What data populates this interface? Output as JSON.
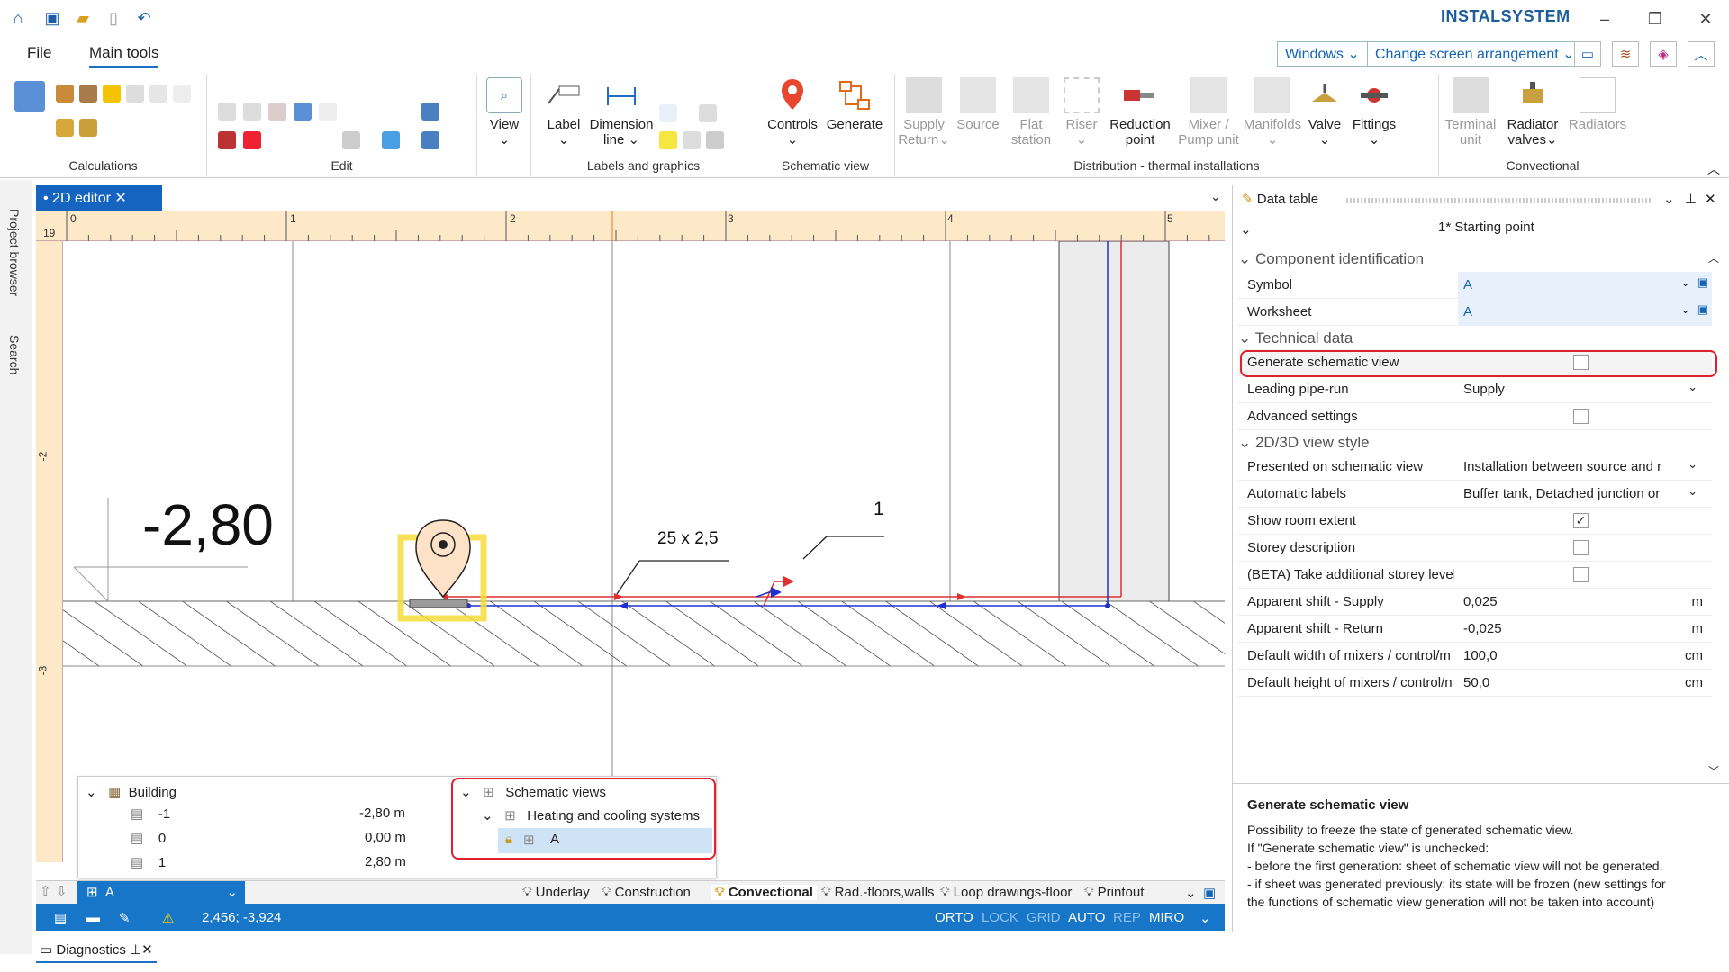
{
  "app": {
    "brand": "INSTALSYSTEM"
  },
  "menu": {
    "file": "File",
    "main_tools": "Main tools"
  },
  "toolbar": {
    "windows": "Windows",
    "arrangement": "Change screen arrangement"
  },
  "ribbon": {
    "calculations": "Calculations",
    "edit": "Edit",
    "labels_graphics": "Labels and graphics",
    "schematic_view": "Schematic view",
    "distribution": "Distribution - thermal installations",
    "convectional": "Convectional",
    "view": "View",
    "label": "Label",
    "dimension": "Dimension",
    "dimension2": "line",
    "controls": "Controls",
    "generate": "Generate",
    "supply": "Supply",
    "return": "Return",
    "source": "Source",
    "flat": "Flat",
    "station": "station",
    "riser": "Riser",
    "reduction": "Reduction",
    "point": "point",
    "mixer": "Mixer /",
    "pump": "Pump unit",
    "manifolds": "Manifolds",
    "valve": "Valve",
    "fittings": "Fittings",
    "terminal": "Terminal",
    "unit": "unit",
    "radiator": "Radiator",
    "valves": "valves",
    "radiators": "Radiators"
  },
  "left_tabs": {
    "project": "Project browser",
    "search": "Search"
  },
  "editor": {
    "tab": "• 2D editor",
    "ruler_h": [
      "0",
      "1",
      "2",
      "3",
      "4",
      "5"
    ],
    "ruler_v": [
      "-2",
      "-3"
    ],
    "corner": "19",
    "level": "-2,80",
    "pipe_label": "25 x 2,5",
    "marker": "1"
  },
  "tree": {
    "building": "Building",
    "levels": [
      {
        "name": "-1",
        "value": "-2,80 m"
      },
      {
        "name": "0",
        "value": "0,00 m"
      },
      {
        "name": "1",
        "value": "2,80 m"
      }
    ],
    "schematic": "Schematic views",
    "heating": "Heating and cooling systems",
    "sheet": "A"
  },
  "bottom": {
    "sheet": "A",
    "tabs": [
      "Underlay",
      "Construction",
      "Convectional",
      "Rad.-floors,walls",
      "Loop drawings-floor",
      "Printout"
    ]
  },
  "status": {
    "coords": "2,456; -3,924",
    "orto": "ORTO",
    "lock": "LOCK",
    "grid": "GRID",
    "auto": "AUTO",
    "rep": "REP",
    "miro": "MIRO"
  },
  "diagnostics": "Diagnostics",
  "panel": {
    "title": "Data table",
    "object": "1* Starting point",
    "sec1": "Component identification",
    "sec2": "Technical data",
    "sec3": "2D/3D view style",
    "rows": [
      {
        "label": "Symbol",
        "value": "A"
      },
      {
        "label": "Worksheet",
        "value": "A"
      },
      {
        "label": "Generate schematic view",
        "value": ""
      },
      {
        "label": "Leading pipe-run",
        "value": "Supply"
      },
      {
        "label": "Advanced settings",
        "value": ""
      },
      {
        "label": "Presented on schematic view",
        "value": "Installation between source and r"
      },
      {
        "label": "Automatic labels",
        "value": "Buffer tank, Detached junction or"
      },
      {
        "label": "Show room extent",
        "value": "✓"
      },
      {
        "label": "Storey description",
        "value": ""
      },
      {
        "label": "(BETA) Take additional storey levels",
        "value": ""
      },
      {
        "label": "Apparent shift - Supply",
        "value": "0,025",
        "unit": "m"
      },
      {
        "label": "Apparent shift - Return",
        "value": "-0,025",
        "unit": "m"
      },
      {
        "label": "Default width of mixers / control/m",
        "value": "100,0",
        "unit": "cm"
      },
      {
        "label": "Default height of mixers / control/n",
        "value": "50,0",
        "unit": "cm"
      }
    ],
    "help_title": "Generate schematic view",
    "help": [
      "Possibility to freeze the state of generated schematic view.",
      "If \"Generate schematic view\" is unchecked:",
      "- before the first generation: sheet of schematic view will not be generated.",
      "- if sheet was generated previously: its state will be frozen (new settings for",
      "the functions of schematic view generation will not be taken into account)"
    ]
  }
}
